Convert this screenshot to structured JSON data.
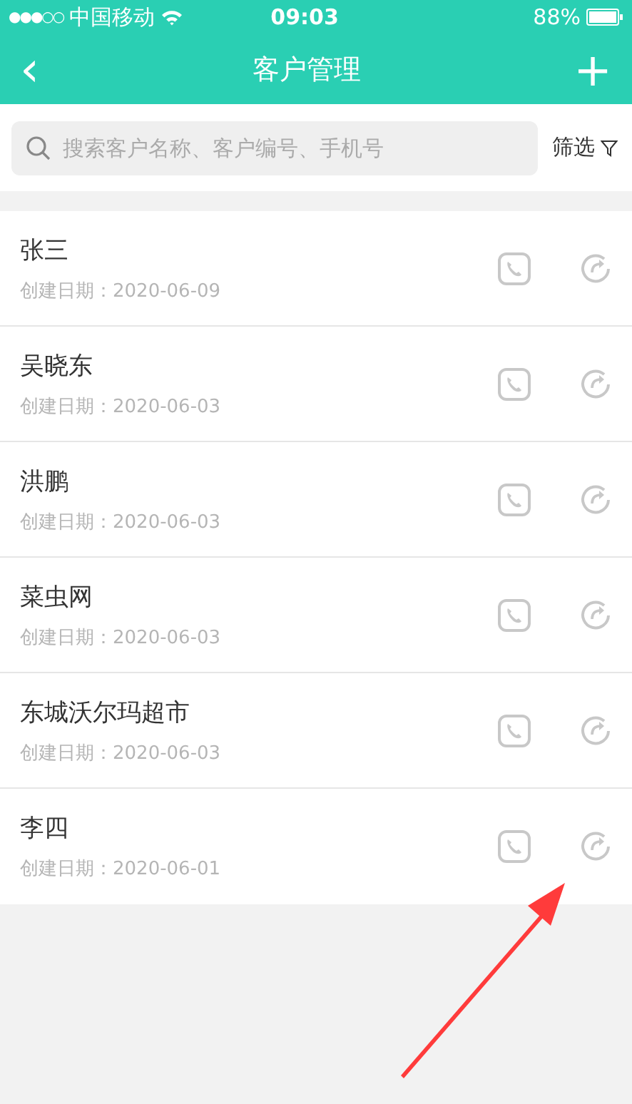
{
  "status_bar": {
    "signal": "●●●○○",
    "carrier": "中国移动",
    "time": "09:03",
    "battery": "88%"
  },
  "nav": {
    "back": "‹",
    "title": "客户管理",
    "add": "+"
  },
  "search": {
    "placeholder": "搜索客户名称、客户编号、手机号"
  },
  "filter": {
    "label": "筛选"
  },
  "customers": [
    {
      "name": "张三",
      "created": "创建日期：2020-06-09"
    },
    {
      "name": "吴晓东",
      "created": "创建日期：2020-06-03"
    },
    {
      "name": "洪鹏",
      "created": "创建日期：2020-06-03"
    },
    {
      "name": "菜虫网",
      "created": "创建日期：2020-06-03"
    },
    {
      "name": "东城沃尔玛超市",
      "created": "创建日期：2020-06-03"
    },
    {
      "name": "李四",
      "created": "创建日期：2020-06-01"
    }
  ],
  "annotation": {
    "kind": "arrow",
    "color": "#ff3b3b"
  }
}
